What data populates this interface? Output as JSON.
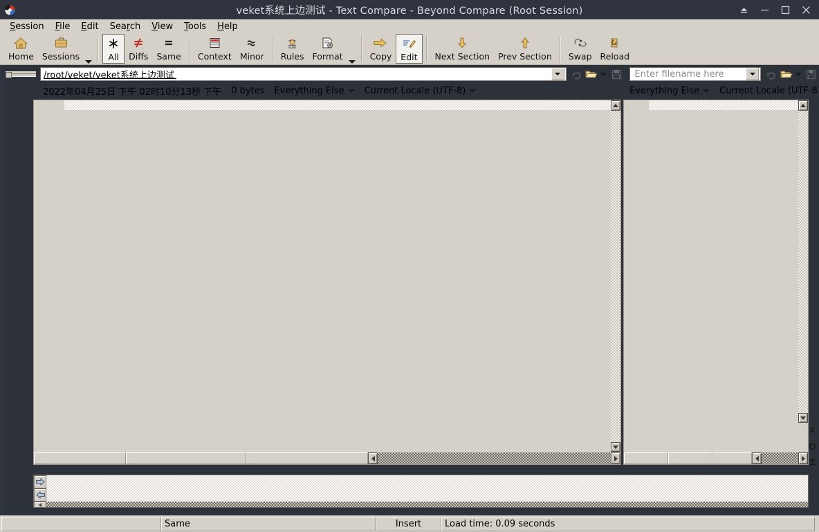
{
  "window": {
    "title": "veket系统上边测试 - Text Compare - Beyond Compare (Root Session)",
    "app_icon": "beyond-compare-logo-icon",
    "controls": {
      "eject": "⏏",
      "minimize": "—",
      "maximize": "□",
      "close": "✕"
    }
  },
  "menubar": [
    {
      "pre": "",
      "mn": "S",
      "post": "ession"
    },
    {
      "pre": "",
      "mn": "F",
      "post": "ile"
    },
    {
      "pre": "",
      "mn": "E",
      "post": "dit"
    },
    {
      "pre": "Sea",
      "mn": "r",
      "post": "ch"
    },
    {
      "pre": "",
      "mn": "V",
      "post": "iew"
    },
    {
      "pre": "",
      "mn": "T",
      "post": "ools"
    },
    {
      "pre": "",
      "mn": "H",
      "post": "elp"
    }
  ],
  "toolbar": {
    "buttons": [
      {
        "label": "Home",
        "icon": "home-icon",
        "active": false,
        "dropdown": false
      },
      {
        "label": "Sessions",
        "icon": "briefcase-icon",
        "active": false,
        "dropdown": true
      },
      {
        "label": "All",
        "icon": "asterisk-icon",
        "active": true,
        "dropdown": false
      },
      {
        "label": "Diffs",
        "icon": "not-equal-icon",
        "active": false,
        "dropdown": false
      },
      {
        "label": "Same",
        "icon": "equals-icon",
        "active": false,
        "dropdown": false
      },
      {
        "label": "Context",
        "icon": "context-icon",
        "active": false,
        "dropdown": false
      },
      {
        "label": "Minor",
        "icon": "approx-equal-icon",
        "active": false,
        "dropdown": false
      },
      {
        "label": "Rules",
        "icon": "referee-icon",
        "active": false,
        "dropdown": false
      },
      {
        "label": "Format",
        "icon": "format-doc-icon",
        "active": false,
        "dropdown": true
      },
      {
        "label": "Copy",
        "icon": "arrow-right-icon",
        "active": false,
        "dropdown": false
      },
      {
        "label": "Edit",
        "icon": "edit-pencil-icon",
        "active": true,
        "dropdown": false
      },
      {
        "label": "Next Section",
        "icon": "arrow-down-icon",
        "active": false,
        "dropdown": false
      },
      {
        "label": "Prev Section",
        "icon": "arrow-up-icon",
        "active": false,
        "dropdown": false
      },
      {
        "label": "Swap",
        "icon": "swap-icon",
        "active": false,
        "dropdown": false
      },
      {
        "label": "Reload",
        "icon": "reload-icon",
        "active": false,
        "dropdown": false
      }
    ]
  },
  "left_pane": {
    "path_value": "/root/veket/veket系统上边测试",
    "path_placeholder": "Enter filename here",
    "info": {
      "timestamp": "2022年04月25日 下午 02时10分13秒 下午",
      "size": "0 bytes",
      "filter": "Everything Else",
      "encoding": "Current Locale (UTF-8)"
    },
    "icons": {
      "dropdown": "chevron-down-icon",
      "refresh": "refresh-icon",
      "browse": "open-folder-icon",
      "save": "save-disk-icon"
    }
  },
  "right_pane": {
    "path_value": "",
    "path_placeholder": "Enter filename here",
    "info": {
      "filter": "Everything Else",
      "encoding": "Current Locale (UTF-8"
    },
    "icons": {
      "dropdown": "chevron-down-icon",
      "refresh": "refresh-icon",
      "browse": "open-folder-icon",
      "save": "save-disk-icon"
    }
  },
  "diff_nav": {
    "first": "first-difference-icon",
    "current": "current-difference-icon",
    "last": "last-difference-icon"
  },
  "edit_panel": {
    "copy_right_icon": "arrow-right-icon",
    "copy_left_icon": "arrow-left-icon"
  },
  "statusbar": {
    "left": "",
    "compare_result": "Same",
    "insert_mode": "Insert",
    "load_time": "Load time: 0.09 seconds"
  },
  "colors": {
    "chrome": "#d6d1c8",
    "titlebar": "#2f343f",
    "title_text": "#d8dbe0",
    "accent_gold": "#e0a93b",
    "diff_red": "#c03030"
  }
}
